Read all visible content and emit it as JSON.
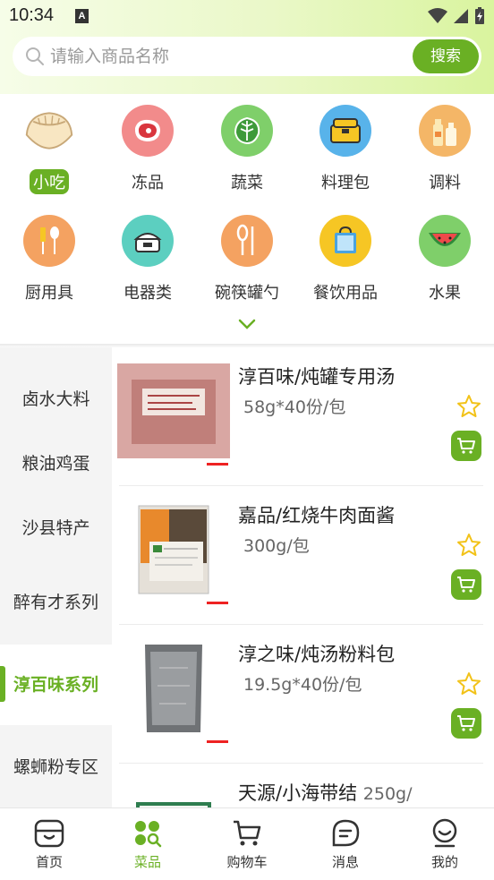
{
  "status_bar": {
    "time": "10:34",
    "a_badge": "A"
  },
  "search": {
    "placeholder": "请输入商品名称",
    "button": "搜索"
  },
  "categories": [
    {
      "label": "小吃",
      "icon": "dumpling-icon",
      "active": true
    },
    {
      "label": "冻品",
      "icon": "meat-icon"
    },
    {
      "label": "蔬菜",
      "icon": "lettuce-icon"
    },
    {
      "label": "料理包",
      "icon": "lunchbox-icon"
    },
    {
      "label": "调料",
      "icon": "seasoning-bottles-icon"
    },
    {
      "label": "厨用具",
      "icon": "kitchen-utensils-icon"
    },
    {
      "label": "电器类",
      "icon": "rice-cooker-icon"
    },
    {
      "label": "碗筷罐勺",
      "icon": "spoon-icon"
    },
    {
      "label": "餐饮用品",
      "icon": "shopping-bag-icon"
    },
    {
      "label": "水果",
      "icon": "watermelon-icon"
    }
  ],
  "sidebar": {
    "items": [
      {
        "label": "卤水大料"
      },
      {
        "label": "粮油鸡蛋"
      },
      {
        "label": "沙县特产"
      },
      {
        "label": "醉有才系列"
      },
      {
        "label": "淳百味系列",
        "active": true
      },
      {
        "label": "螺蛳粉专区"
      }
    ]
  },
  "products": [
    {
      "name": "淳百味/炖罐专用汤",
      "spec": "58g*40份/包"
    },
    {
      "name": "嘉品/红烧牛肉面酱",
      "spec": "300g/包"
    },
    {
      "name": "淳之味/炖汤粉料包",
      "spec": "19.5g*40份/包"
    },
    {
      "name": "天源/小海带结",
      "spec": "250g/"
    }
  ],
  "tabs": [
    {
      "label": "首页",
      "icon": "home-icon"
    },
    {
      "label": "菜品",
      "icon": "menu-grid-icon",
      "active": true
    },
    {
      "label": "购物车",
      "icon": "cart-icon"
    },
    {
      "label": "消息",
      "icon": "message-icon"
    },
    {
      "label": "我的",
      "icon": "profile-icon"
    }
  ],
  "colors": {
    "accent": "#6ab024",
    "star": "#f2c218",
    "sidebar_bg": "#f4f4f4"
  }
}
